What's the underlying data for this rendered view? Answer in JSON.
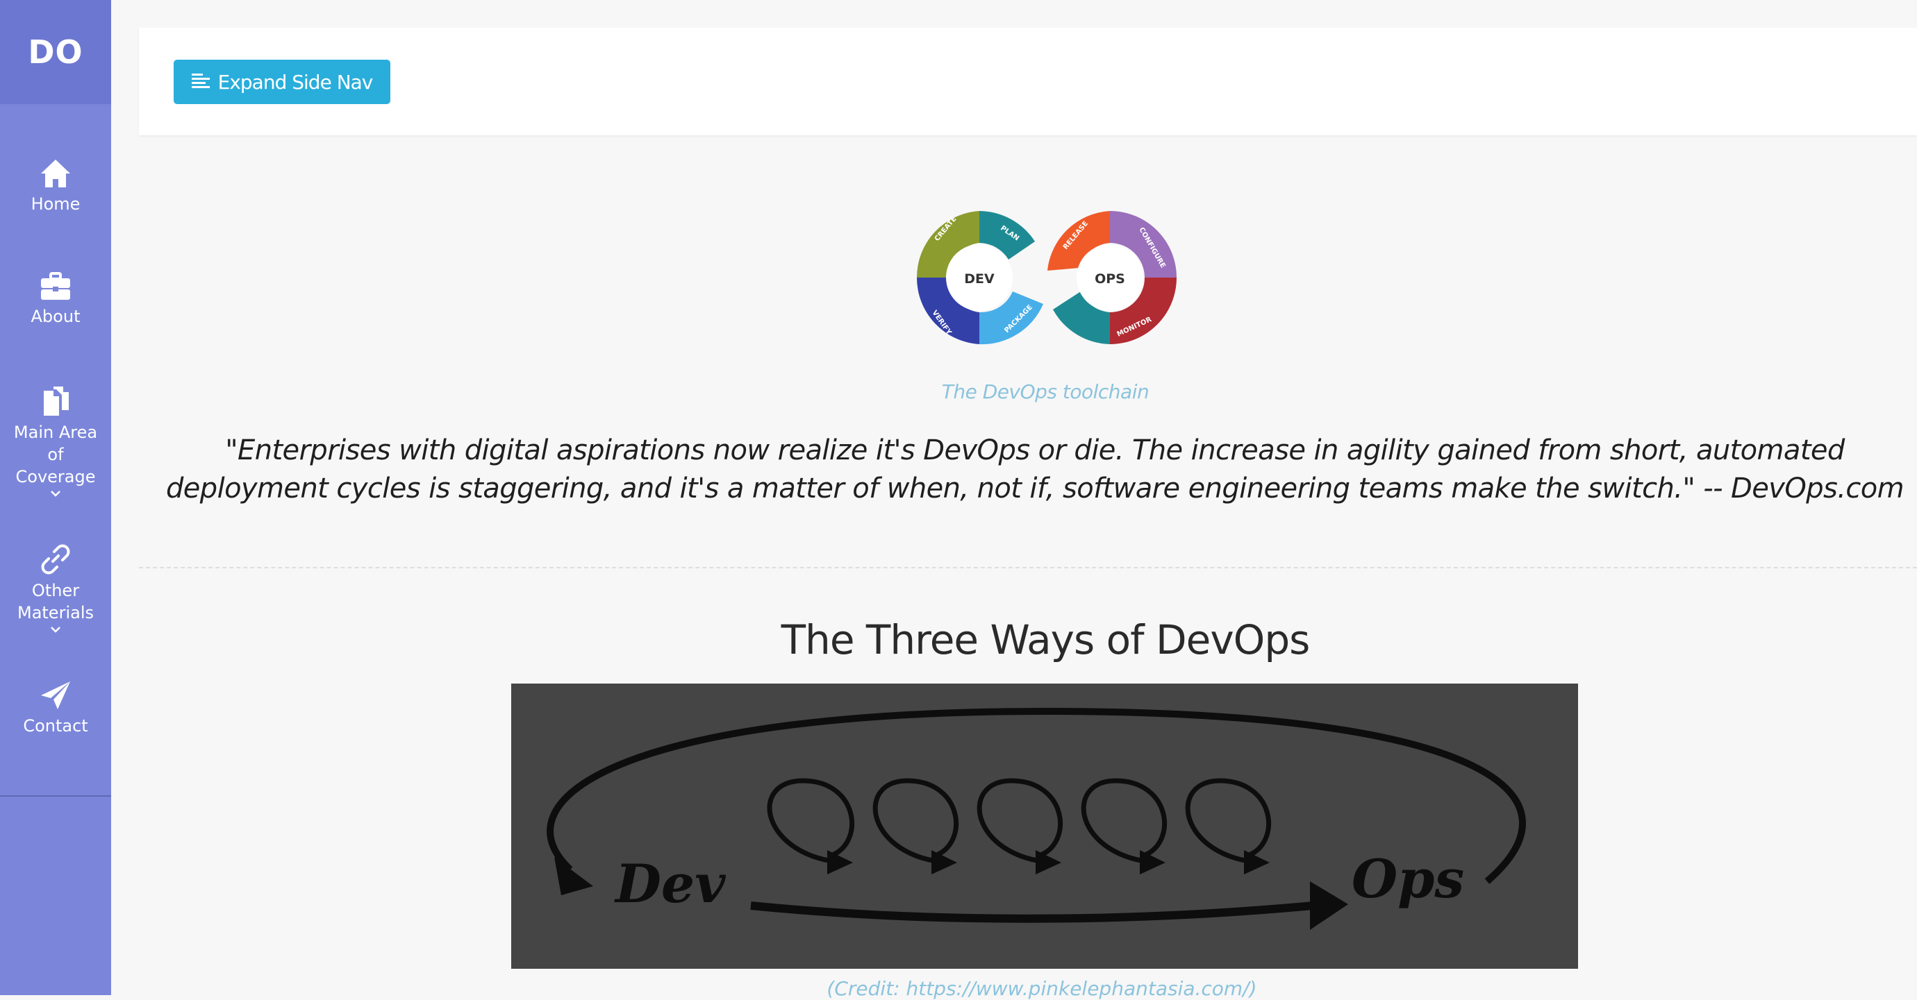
{
  "brand": {
    "text": "DO"
  },
  "sidebar": {
    "items": [
      {
        "label": "Home",
        "icon": "home-icon"
      },
      {
        "label": "About",
        "icon": "briefcase-icon"
      },
      {
        "label": "Main Area of Coverage",
        "line1": "Main Area",
        "line2": "of",
        "line3": "Coverage",
        "icon": "documents-icon",
        "has_dropdown": true
      },
      {
        "label": "Other Materials",
        "line1": "Other",
        "line2": "Materials",
        "icon": "link-icon",
        "has_dropdown": true
      },
      {
        "label": "Contact",
        "icon": "paper-plane-icon"
      }
    ]
  },
  "topbar": {
    "expand_button_label": "Expand Side Nav",
    "expand_icon": "align-left-icon"
  },
  "toolchain": {
    "dev_label": "DEV",
    "ops_label": "OPS",
    "segments": [
      "CREATE",
      "PLAN",
      "RELEASE",
      "CONFIGURE",
      "MONITOR",
      "PACKAGE",
      "VERIFY"
    ],
    "caption": "The DevOps toolchain"
  },
  "quote": {
    "line1": "\"Enterprises with digital aspirations now realize it's DevOps or die. The increase in agility gained from short, automated",
    "line2": "deployment cycles is staggering, and it's a matter of when, not if, software engineering teams make the switch.\" -- DevOps.com"
  },
  "section": {
    "heading": "The Three Ways of DevOps",
    "image_dev_label": "Dev",
    "image_ops_label": "Ops",
    "credit": "(Credit: https://www.pinkelephantasia.com/)"
  },
  "colors": {
    "sidebar_bg": "#7b86da",
    "brand_bg": "#6c77d1",
    "button_bg": "#29aedc",
    "caption_color": "#8cc3dd"
  }
}
